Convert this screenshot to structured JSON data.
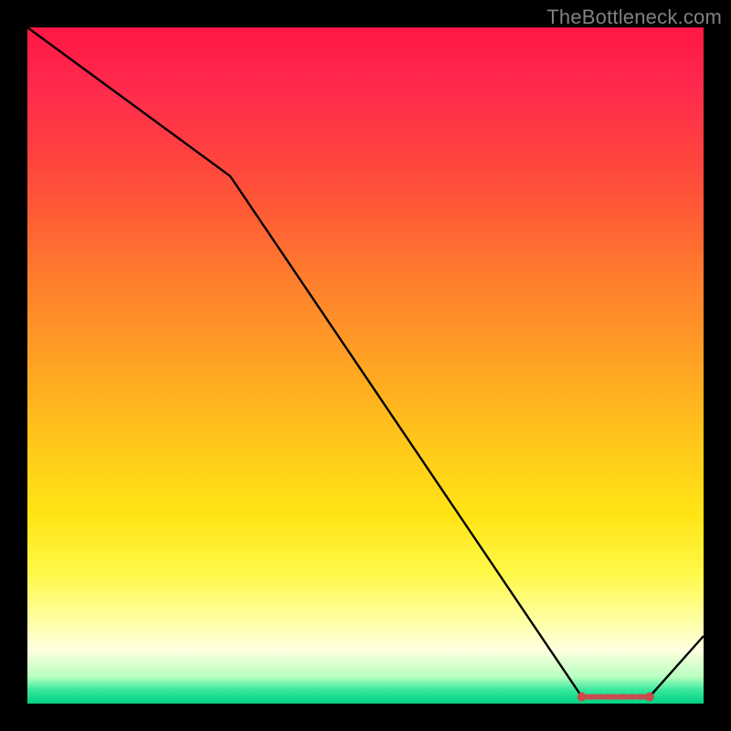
{
  "watermark": "TheBottleneck.com",
  "chart_data": {
    "type": "line",
    "title": "",
    "xlabel": "",
    "ylabel": "",
    "xlim": [
      0,
      100
    ],
    "ylim": [
      0,
      100
    ],
    "x": [
      0,
      30,
      82,
      92,
      100
    ],
    "values": [
      100,
      78,
      1,
      1,
      10
    ],
    "highlight_range_x": [
      82,
      92
    ],
    "line_color": "#000000",
    "highlight_color": "#c94c4c",
    "gradient_stops": [
      {
        "pos": 0,
        "color": "#ff1744"
      },
      {
        "pos": 9,
        "color": "#ff2a4d"
      },
      {
        "pos": 18,
        "color": "#ff4040"
      },
      {
        "pos": 27,
        "color": "#ff5a36"
      },
      {
        "pos": 36,
        "color": "#ff7a2e"
      },
      {
        "pos": 45,
        "color": "#ff9528"
      },
      {
        "pos": 54,
        "color": "#ffb020"
      },
      {
        "pos": 63,
        "color": "#ffcc1a"
      },
      {
        "pos": 72,
        "color": "#ffe414"
      },
      {
        "pos": 81,
        "color": "#fff94a"
      },
      {
        "pos": 88,
        "color": "#ffffa8"
      },
      {
        "pos": 92,
        "color": "#ffffe0"
      },
      {
        "pos": 96,
        "color": "#b9ffc0"
      },
      {
        "pos": 98,
        "color": "#38e89a"
      },
      {
        "pos": 100,
        "color": "#00d084"
      }
    ]
  }
}
